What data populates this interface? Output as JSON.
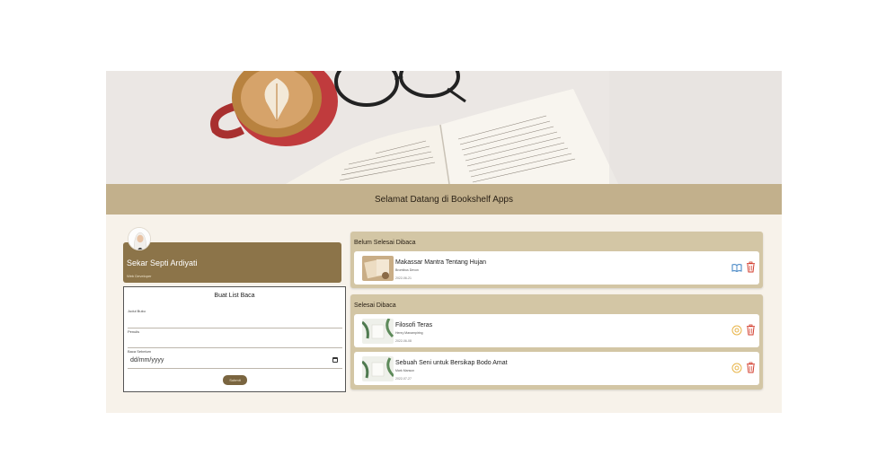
{
  "banner": {
    "title": "Selamat Datang di Bookshelf Apps"
  },
  "profile": {
    "name": "Sekar Septi Ardiyati",
    "role": "Web Developer"
  },
  "form": {
    "title": "Buat List Baca",
    "title_label": "Judul Buku",
    "author_label": "Penulis",
    "date_label": "Baca Sebelum",
    "date_value": "dd/mm/yyyy",
    "submit_label": "Submit"
  },
  "unread": {
    "title": "Belum Selesai Dibaca",
    "books": [
      {
        "title": "Makassar Mantra Tentang Hujan",
        "author": "Bromibus Devon",
        "date": "2022-06-21"
      }
    ]
  },
  "read": {
    "title": "Selesai Dibaca",
    "books": [
      {
        "title": "Filosofi Teras",
        "author": "Henry Manampiring",
        "date": "2022-06-08"
      },
      {
        "title": "Sebuah Seni untuk Bersikap Bodo Amat",
        "author": "Mark Manson",
        "date": "2022-07-27"
      }
    ]
  },
  "colors": {
    "banner": "#c2b08c",
    "profile_card": "#8c7449",
    "shelf": "#d3c6a5",
    "read_icon": "#3a7fc1",
    "undo_icon": "#e8b54a",
    "delete_icon": "#d23a2a"
  },
  "icons": {
    "move_to_read": "book-open-icon",
    "move_to_unread": "undo-icon",
    "delete": "trash-icon"
  }
}
